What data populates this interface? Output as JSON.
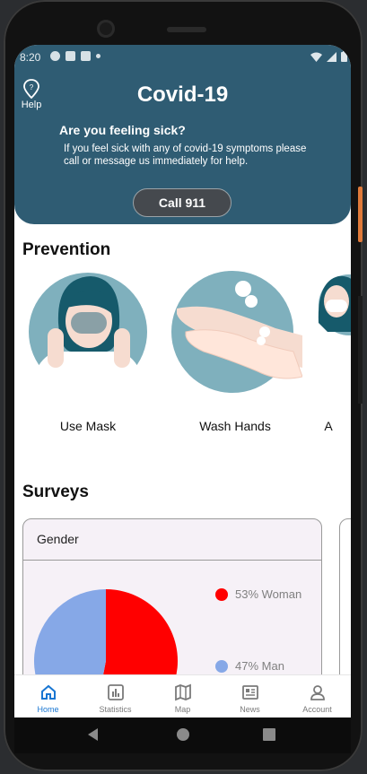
{
  "status": {
    "time": "8:20"
  },
  "header": {
    "help_label": "Help",
    "title": "Covid-19",
    "question": "Are you feeling sick?",
    "message": "If you feel sick with any of covid-19 symptoms please call or message us immediately for help.",
    "call_label": "Call 911"
  },
  "prevention": {
    "title": "Prevention",
    "items": [
      {
        "label": "Use Mask",
        "icon": "mask-illustration"
      },
      {
        "label": "Wash Hands",
        "icon": "wash-hands-illustration"
      },
      {
        "label": "A",
        "icon": "partial-illustration"
      }
    ]
  },
  "surveys": {
    "title": "Surveys",
    "card": {
      "title": "Gender",
      "legend": [
        {
          "label": "53% Woman",
          "color": "#ff0000"
        },
        {
          "label": "47% Man",
          "color": "#86a8e7"
        }
      ]
    }
  },
  "chart_data": {
    "type": "pie",
    "title": "Gender",
    "categories": [
      "Woman",
      "Man"
    ],
    "values": [
      53,
      47
    ],
    "colors": [
      "#ff0000",
      "#86a8e7"
    ]
  },
  "nav": {
    "items": [
      {
        "label": "Home",
        "icon": "home-icon"
      },
      {
        "label": "Statistics",
        "icon": "statistics-icon"
      },
      {
        "label": "Map",
        "icon": "map-icon"
      },
      {
        "label": "News",
        "icon": "news-icon"
      },
      {
        "label": "Account",
        "icon": "account-icon"
      }
    ],
    "active_index": 0,
    "active_color": "#1976d2"
  },
  "colors": {
    "header": "#2f5c73",
    "illustration": "#7fb0bd"
  }
}
